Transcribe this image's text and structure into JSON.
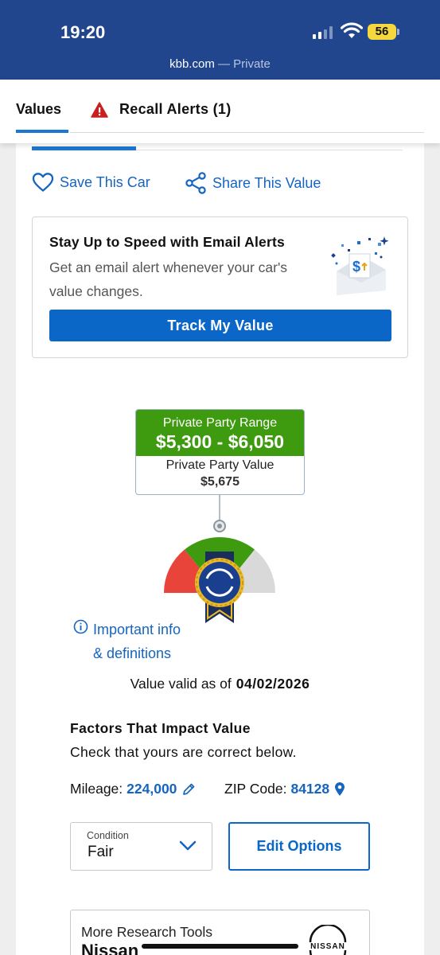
{
  "status_bar": {
    "time": "19:20",
    "battery": "56"
  },
  "browser": {
    "domain": "kbb.com",
    "mode": "— Private"
  },
  "tabs": {
    "values": "Values",
    "recall_alerts": "Recall Alerts (1)"
  },
  "actions": {
    "save": "Save This Car",
    "share": "Share This Value"
  },
  "email_alert": {
    "title": "Stay Up to Speed with Email Alerts",
    "description": "Get an email alert whenever your car's value changes.",
    "button": "Track My Value"
  },
  "valuation": {
    "range_label": "Private Party Range",
    "range_value": "$5,300 - $6,050",
    "value_label": "Private Party Value",
    "value_amount": "$5,675",
    "info_link_line1": "Important info",
    "info_link_line2": "& definitions",
    "valid_label": "Value valid as of",
    "valid_date": "04/02/2026"
  },
  "factors": {
    "title": "Factors That Impact Value",
    "subtitle": "Check that yours are correct below.",
    "mileage_label": "Mileage:",
    "mileage_value": "224,000",
    "zip_label": "ZIP Code:",
    "zip_value": "84128",
    "condition_label": "Condition",
    "condition_value": "Fair",
    "edit_options": "Edit Options"
  },
  "research": {
    "label": "More Research Tools",
    "make": "Nissan",
    "logo_text": "NISSAN"
  },
  "colors": {
    "header_blue": "#21468e",
    "link_blue": "#1565c0",
    "button_blue": "#0a66c7",
    "range_green": "#3e9a0e",
    "gauge_red": "#e8443a",
    "gauge_gray": "#d9d9d9"
  }
}
